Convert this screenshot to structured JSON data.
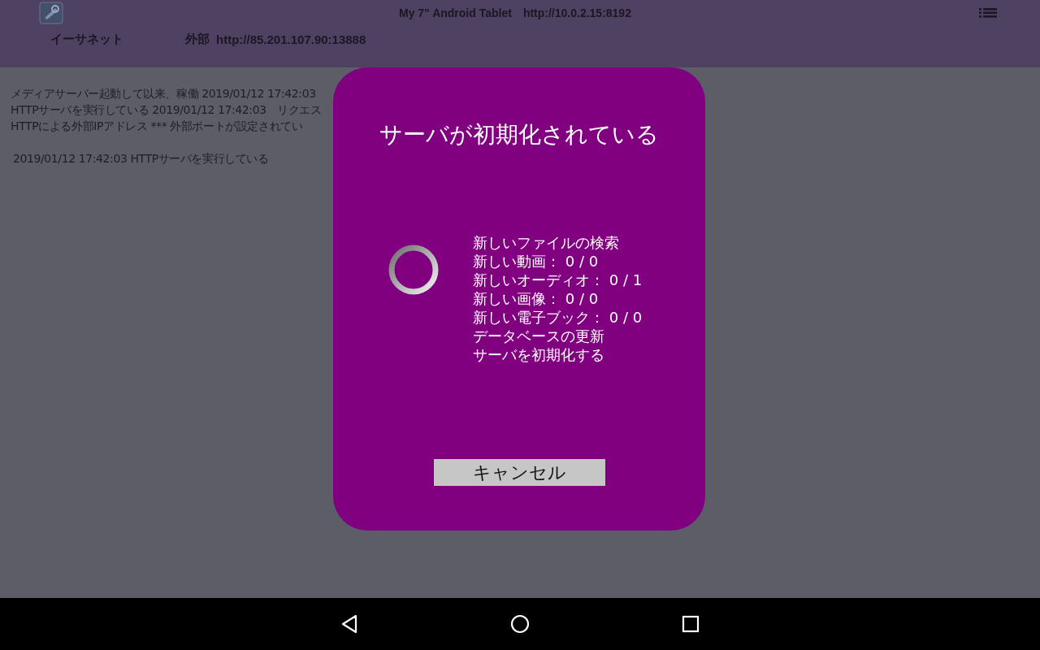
{
  "header": {
    "title": "My 7\" Android Tablet",
    "server_url": "http://10.0.2.15:8192",
    "network": "イーサネット",
    "external_label": "外部",
    "external_url": "http://85.201.107.90:13888"
  },
  "log": {
    "lines": [
      "メディアサーバー起動して以来、稼働 2019/01/12 17:42:03",
      "HTTPサーバを実行している 2019/01/12 17:42:03　リクエス",
      "HTTPによる外部IPアドレス *** 外部ポートが設定されてい"
    ],
    "entries": [
      "2019/01/12 17:42:03 HTTPサーバを実行している"
    ]
  },
  "dialog": {
    "title": "サーバが初期化されている",
    "status_lines": [
      "新しいファイルの検索",
      "新しい動画： 0 / 0",
      "新しいオーディオ： 0 / 1",
      "新しい画像： 0 / 0",
      "新しい電子ブック： 0 / 0",
      "データベースの更新",
      "サーバを初期化する"
    ],
    "cancel_button": "キャンセル"
  }
}
